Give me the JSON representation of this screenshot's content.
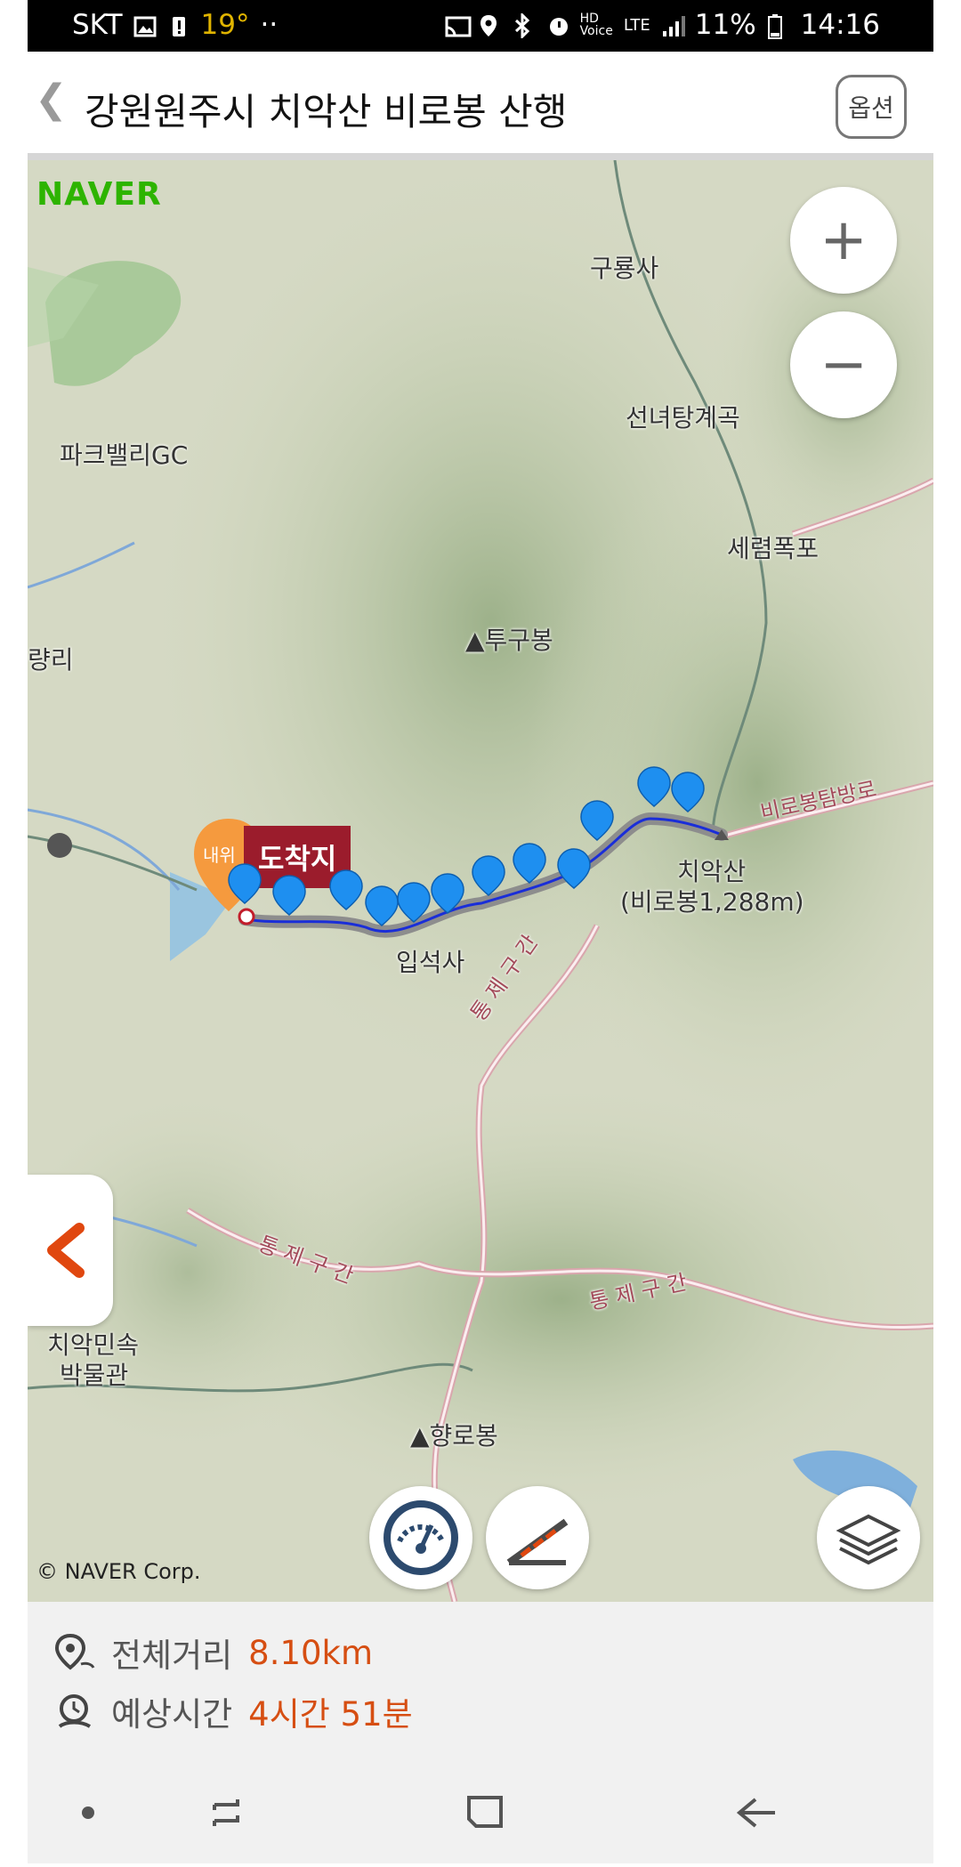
{
  "status_bar": {
    "carrier": "SKT",
    "temperature": "19°",
    "network": "LTE",
    "battery": "11%",
    "time": "14:16"
  },
  "app_bar": {
    "title": "강원원주시 치악산 비로봉 산행",
    "options_label": "옵션"
  },
  "map": {
    "brand": "NAVER",
    "copyright": "© NAVER Corp.",
    "arrival_label": "도착지",
    "labels": [
      "구룡사",
      "선녀탕계곡",
      "파크밸리GC",
      "세렴폭포",
      "▲투구봉",
      "량리",
      "치악산",
      "(비로봉1,288m)",
      "입석사",
      "치악민속",
      "박물관",
      "▲향로봉"
    ],
    "road_labels": [
      "비로봉탐방로",
      "통 제 구 간",
      "통 제 구 간",
      "통 제 구 간"
    ]
  },
  "summary": {
    "distance_label": "전체거리",
    "distance_value": "8.10km",
    "time_label": "예상시간",
    "time_value": "4시간 51분"
  },
  "colors": {
    "accent": "#d64e12",
    "route_blue": "#1a2ed8",
    "marker_blue": "#1e8ff0",
    "arrival_red": "#9b1c2c"
  }
}
